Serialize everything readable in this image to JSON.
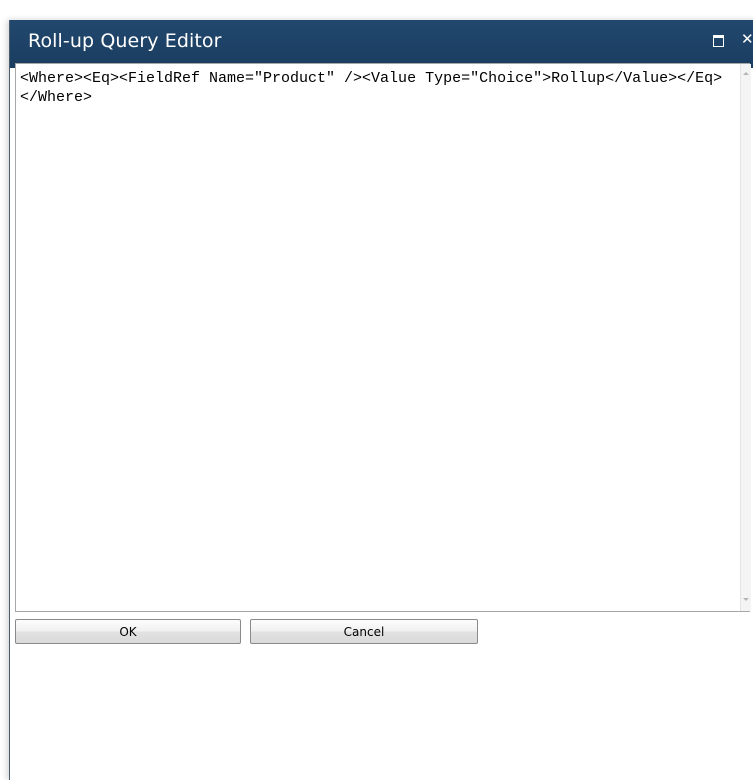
{
  "dialog": {
    "title": "Roll-up Query Editor",
    "icons": {
      "maximize": "maximize-icon",
      "close": "close-icon"
    },
    "query_text": "<Where><Eq><FieldRef Name=\"Product\" /><Value Type=\"Choice\">Rollup</Value></Eq></Where>",
    "buttons": {
      "ok_label": "OK",
      "cancel_label": "Cancel"
    }
  },
  "colors": {
    "titlebar": "#1d4166",
    "title_text": "#ffffff",
    "editor_border": "#a7a7a7"
  }
}
